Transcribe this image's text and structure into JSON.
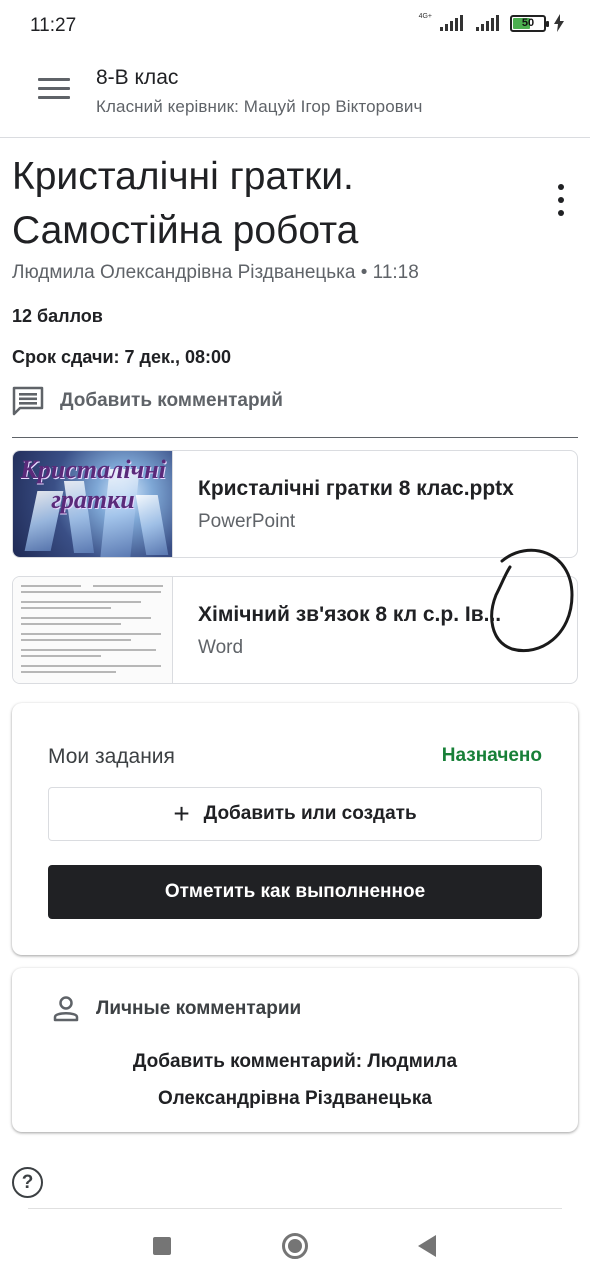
{
  "status_bar": {
    "time": "11:27",
    "network": "4G+",
    "battery": "50",
    "icons": [
      "signal-icon",
      "signal-icon",
      "battery-icon",
      "charging-icon"
    ]
  },
  "header": {
    "class_name": "8-В клас",
    "teacher_line": "Класний керівник: Мацуй Ігор Вікторович",
    "menu_icon": "hamburger-menu-icon"
  },
  "assignment": {
    "title": "Кристалічні гратки. Самостійна робота",
    "author_line": "Людмила Олександрівна Різдванецька • 11:18",
    "points": "12 баллов",
    "due": "Срок сдачи: 7 дек., 08:00",
    "add_comment_label": "Добавить комментарий",
    "more_icon": "more-vert-icon"
  },
  "attachments": [
    {
      "title": "Кристалічні гратки 8 клас.pptx",
      "type": "PowerPoint",
      "thumb_text_line1": "Кристалічні",
      "thumb_text_line2": "гратки"
    },
    {
      "title": "Хімічний зв'язок 8 кл с.р. Ів...",
      "type": "Word"
    }
  ],
  "my_work": {
    "title": "Мои задания",
    "status": "Назначено",
    "status_color": "#188038",
    "add_button": "Добавить или создать",
    "mark_done_button": "Отметить как выполненное"
  },
  "private_comments": {
    "title": "Личные комментарии",
    "add_line1": "Добавить комментарий: Людмила",
    "add_line2": "Олександрівна Різдванецька"
  },
  "colors": {
    "accent_dark": "#202124",
    "secondary_text": "#5f6368",
    "assigned_green": "#188038"
  }
}
